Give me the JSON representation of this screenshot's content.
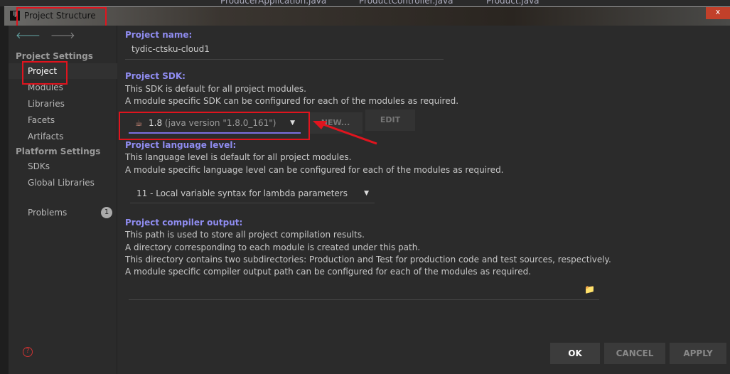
{
  "ide_tabs": [
    "ProducerApplication.java",
    "ProductController.java",
    "Product.java"
  ],
  "window": {
    "title": "Project Structure",
    "close": "x"
  },
  "nav": {
    "back": "🡐",
    "forward": "🡒"
  },
  "sidebar": {
    "project_settings": "Project Settings",
    "items": [
      "Project",
      "Modules",
      "Libraries",
      "Facets",
      "Artifacts"
    ],
    "platform_settings": "Platform Settings",
    "platform_items": [
      "SDKs",
      "Global Libraries"
    ],
    "problems": "Problems",
    "problems_count": "1"
  },
  "main": {
    "name_label": "Project name:",
    "name_value": "tydic-ctsku-cloud1",
    "sdk_label": "Project SDK:",
    "sdk_desc1": "This SDK is default for all project modules.",
    "sdk_desc2": "A module specific SDK can be configured for each of the modules as required.",
    "sdk_version": "1.8",
    "sdk_detail": "(java version \"1.8.0_161\")",
    "new_button": "NEW...",
    "edit_button": "EDIT",
    "lang_label": "Project language level:",
    "lang_desc1": "This language level is default for all project modules.",
    "lang_desc2": "A module specific language level can be configured for each of the modules as required.",
    "lang_value": "11 - Local variable syntax for lambda parameters",
    "out_label": "Project compiler output:",
    "out_desc1": "This path is used to store all project compilation results.",
    "out_desc2": "A directory corresponding to each module is created under this path.",
    "out_desc3": "This directory contains two subdirectories: Production and Test for production code and test sources, respectively.",
    "out_desc4": "A module specific compiler output path can be configured for each of the modules as required.",
    "out_value": ""
  },
  "footer": {
    "ok": "OK",
    "cancel": "CANCEL",
    "apply": "APPLY"
  }
}
